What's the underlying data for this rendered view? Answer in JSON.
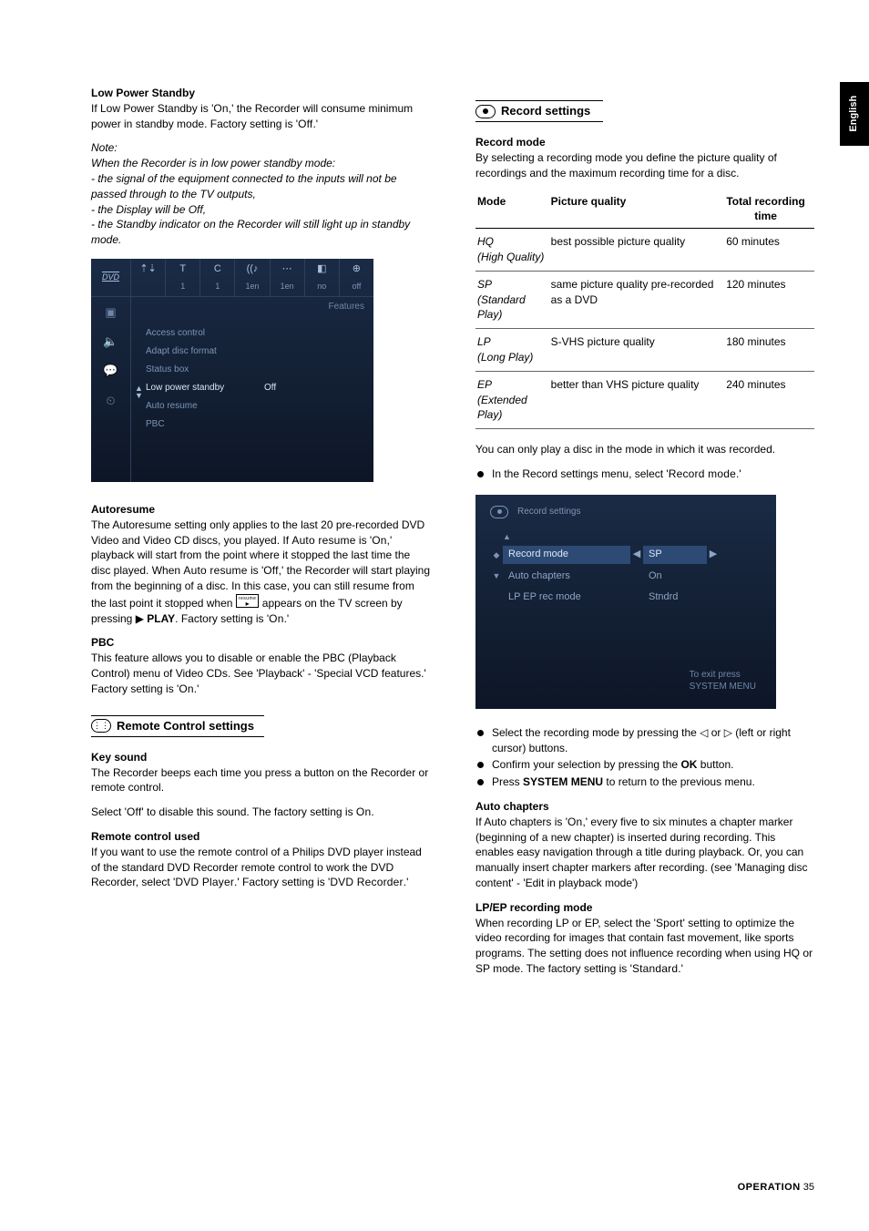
{
  "side_tab": "English",
  "left": {
    "lps": {
      "title": "Low Power Standby",
      "body1_pre": "If Low Power Standby is '",
      "body1_on": "On",
      "body1_mid": ",' the Recorder will consume minimum power in standby mode. Factory setting is '",
      "body1_off": "Off",
      "body1_end": ".'",
      "note_label": "Note:",
      "note1": "When the Recorder is in low power standby mode:",
      "note2": "- the signal of the equipment connected to the inputs will not be passed through to the TV outputs,",
      "note3": "- the Display will be Off,",
      "note4": "- the Standby indicator on the Recorder will still light up in standby mode."
    },
    "ui1": {
      "logo": "DVD",
      "top": [
        {
          "sym": "⇡⇣",
          "v": ""
        },
        {
          "sym": "T",
          "v": "1"
        },
        {
          "sym": "C",
          "v": "1"
        },
        {
          "sym": "((♪",
          "v": "1en"
        },
        {
          "sym": "⋯",
          "v": "1en"
        },
        {
          "sym": "◧",
          "v": "no"
        },
        {
          "sym": "⊕",
          "v": "off"
        }
      ],
      "side": [
        "▣",
        "🔈",
        "💬",
        "⏲"
      ],
      "features": "Features",
      "rows": [
        {
          "label": "Access control",
          "value": ""
        },
        {
          "label": "Adapt disc format",
          "value": ""
        },
        {
          "label": "Status box",
          "value": ""
        },
        {
          "label": "Low power standby",
          "value": "Off",
          "active": true
        },
        {
          "label": "Auto resume",
          "value": ""
        },
        {
          "label": "PBC",
          "value": ""
        }
      ]
    },
    "autoresume": {
      "title": "Autoresume",
      "p1_a": "The Autoresume setting only applies to the last 20 pre-recorded DVD Video and Video CD discs, you played. If ",
      "p1_ar": "Auto resume",
      "p1_b": " is '",
      "p1_on": "On",
      "p1_c": ",' playback will start from the point where it stopped the last time the disc played. When ",
      "p1_ar2": "Auto resume",
      "p1_d": " is '",
      "p1_off": "Off",
      "p1_e": ",' the Recorder will start playing from the beginning of a disc. In this case, you can still resume from the last point it stopped when ",
      "p1_f": " appears on the TV screen by pressing ▶ ",
      "p1_play": "PLAY",
      "p1_g": ". Factory setting is '",
      "p1_on2": "On",
      "p1_h": ".'"
    },
    "pbc": {
      "title": "PBC",
      "body_a": "This feature allows you to disable or enable the PBC (Playback Control) menu of Video CDs. See 'Playback' - 'Special VCD features.' Factory setting is '",
      "body_on": "On",
      "body_b": ".'"
    },
    "remote": {
      "heading": "Remote Control settings",
      "key_title": "Key sound",
      "key_p1": "The Recorder beeps each time you press a button on the Recorder or remote control.",
      "key_p2_a": "Select '",
      "key_off": "Off",
      "key_p2_b": "' to disable this sound. The factory setting is ",
      "key_on": "On",
      "key_p2_c": ".",
      "used_title": "Remote control used",
      "used_p_a": "If you want to use the remote control of a Philips DVD player instead of the standard DVD Recorder remote control to work the DVD Recorder, select '",
      "used_dvdplayer": "DVD Player",
      "used_p_b": ".' Factory setting is '",
      "used_dvdrec": "DVD Recorder",
      "used_p_c": ".'"
    }
  },
  "right": {
    "record": {
      "heading": "Record settings",
      "mode_title": "Record mode",
      "mode_intro": "By selecting a recording mode you define the picture quality of recordings and the maximum recording time for a disc.",
      "table": {
        "h1": "Mode",
        "h2": "Picture quality",
        "h3": "Total recording time",
        "rows": [
          {
            "abbr": "HQ",
            "full": "(High Quality)",
            "q": "best possible picture quality",
            "t": "60 minutes"
          },
          {
            "abbr": "SP",
            "full": "(Standard Play)",
            "q": "same picture quality pre-recorded as a DVD",
            "t": "120 minutes"
          },
          {
            "abbr": "LP",
            "full": "(Long Play)",
            "q": "S-VHS picture quality",
            "t": "180 minutes"
          },
          {
            "abbr": "EP",
            "full": "(Extended Play)",
            "q": "better than VHS picture quality",
            "t": "240 minutes"
          }
        ]
      },
      "after_table": "You can only play a disc in the mode in which it was recorded.",
      "bullet1_a": "In the Record settings menu, select '",
      "bullet1_rm": "Record mode",
      "bullet1_b": ".'"
    },
    "ui2": {
      "title": "Record settings",
      "rows": [
        {
          "label": "Record mode",
          "value": "SP",
          "sel": true
        },
        {
          "label": "Auto chapters",
          "value": "On"
        },
        {
          "label": "LP EP rec mode",
          "value": "Stndrd"
        }
      ],
      "footer1": "To exit press",
      "footer2": "SYSTEM MENU"
    },
    "after_ui_bullets": {
      "b1": "Select the recording mode by pressing the ◁ or ▷ (left or right cursor) buttons.",
      "b2_a": "Confirm your selection by pressing the ",
      "b2_ok": "OK",
      "b2_b": " button.",
      "b3_a": "Press ",
      "b3_sm": "SYSTEM MENU",
      "b3_b": " to return to the previous menu."
    },
    "auto_ch": {
      "title": "Auto chapters",
      "body_a": "If Auto chapters is '",
      "body_on": "On",
      "body_b": ",' every five to six minutes a chapter marker (beginning of a new chapter) is inserted during recording. This enables easy navigation through a title during playback. Or, you can manually insert chapter markers after recording. (see 'Managing disc content' - 'Edit in playback mode')"
    },
    "lpep": {
      "title": "LP/EP recording mode",
      "body_a": "When recording LP or EP, select the '",
      "body_sport": "Sport",
      "body_b": "' setting to optimize the video recording for images that contain fast movement, like sports programs. The setting does not influence recording when using HQ or SP mode. The factory setting is '",
      "body_std": "Standard",
      "body_c": ".'"
    }
  },
  "footer": {
    "label": "OPERATION",
    "page": "35"
  }
}
